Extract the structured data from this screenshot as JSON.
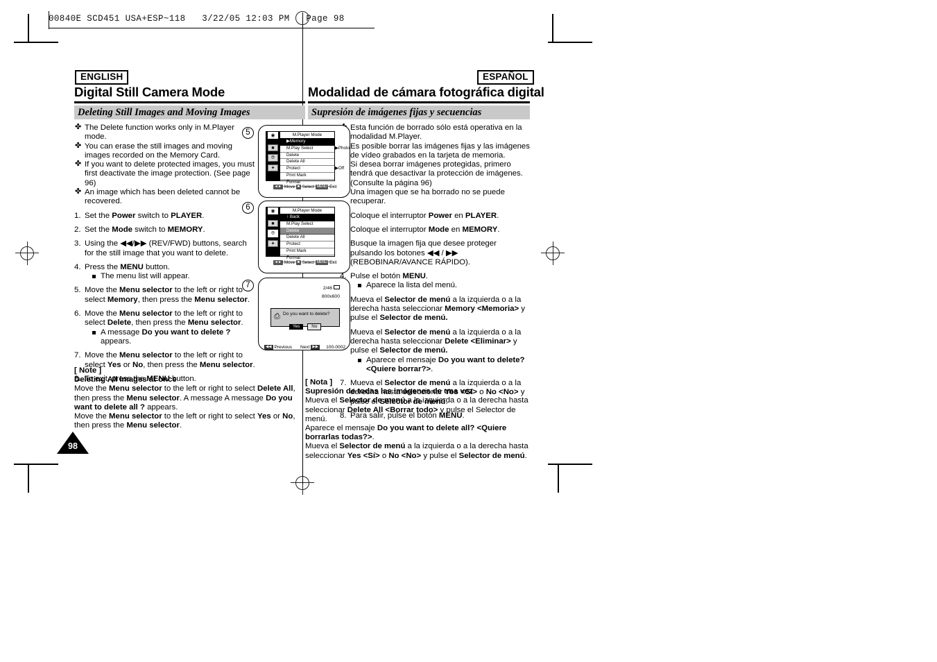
{
  "slug": {
    "text": "00840E SCD451 USA+ESP~118   3/22/05 12:03 PM   Page 98"
  },
  "page_number": "98",
  "english": {
    "lang_tag": "ENGLISH",
    "mode_title": "Digital Still Camera Mode",
    "section_title": "Deleting Still Images and Moving Images",
    "bullet_marker": "✤",
    "bullets": [
      "The Delete function works only in M.Player mode.",
      "You can erase the still images and moving images recorded on the Memory Card.",
      "If you want to delete protected images, you must first deactivate the image protection. (See page 96)",
      "An image which has been deleted cannot be recovered."
    ],
    "steps": [
      {
        "num": "1.",
        "html": "Set the <b>Power</b> switch to <b>PLAYER</b>."
      },
      {
        "num": "2.",
        "html": "Set the <b>Mode</b> switch to <b>MEMORY</b>."
      },
      {
        "num": "3.",
        "html": "Using the ◀◀/▶▶ (REV/FWD) buttons, search for the still image that you want to delete."
      },
      {
        "num": "4.",
        "html": "Press the <b>MENU</b> button.",
        "subs": [
          "The menu list will appear."
        ]
      },
      {
        "num": "5.",
        "html": "Move the <b>Menu selector</b> to the left or right to select <b>Memory</b>, then press the <b>Menu selector</b>."
      },
      {
        "num": "6.",
        "html": "Move the <b>Menu selector</b> to the left or right to select <b>Delete</b>, then press the <b>Menu selector</b>.",
        "subs": [
          "A message <b>Do you want to delete ?</b> appears."
        ]
      },
      {
        "num": "7.",
        "html": "Move the <b>Menu selector</b> to the left or right to select <b>Yes</b> or <b>No</b>, then press the <b>Menu selector</b>."
      },
      {
        "num": "8.",
        "html": "To exit, press the <b>MENU</b> button."
      }
    ],
    "note": {
      "label": "[ Note ]",
      "subtitle": "Deleting All images at once",
      "body_html": "Move the <b>Menu selector</b> to the left or right to select <b>Delete All</b>, then press the <b>Menu selector</b>. A message A message <b>Do you want to delete all ?</b> appears.<br>Move the <b>Menu selector</b> to the left or right to select <b>Yes</b> or <b>No</b>, then press the <b>Menu selector</b>."
    }
  },
  "spanish": {
    "lang_tag": "ESPAÑOL",
    "mode_title": "Modalidad de cámara fotográfica digital",
    "section_title": "Supresión de imágenes fijas y secuencias",
    "bullet_marker": "✤",
    "bullets": [
      "Esta función de borrado sólo está operativa en la modalidad M.Player.",
      "Es posible borrar las imágenes fijas y las imágenes de vídeo grabados en la tarjeta de memoria.",
      "Si desea borrar imágenes protegidas, primero tendrá que desactivar la protección de imágenes. (Consulte la página 96)",
      "Una imagen que se ha borrado no se puede recuperar."
    ],
    "steps": [
      {
        "num": "1.",
        "html": "Coloque el interruptor <b>Power</b> en <b>PLAYER</b>."
      },
      {
        "num": "2.",
        "html": "Coloque el interruptor <b>Mode</b> en <b>MEMORY</b>."
      },
      {
        "num": "3.",
        "html": "Busque la imagen fija que desee proteger pulsando los botones ◀◀ / ▶▶ (REBOBINAR/AVANCE RÁPIDO)."
      },
      {
        "num": "4.",
        "html": "Pulse el botón <b>MENU</b>.",
        "subs": [
          "Aparece la lista del menú."
        ]
      },
      {
        "num": "5.",
        "html": "Mueva el <b>Selector de menú</b> a la izquierda o a la derecha hasta seleccionar <b>Memory &lt;Memoria&gt;</b> y pulse el <b>Selector de menú.</b>"
      },
      {
        "num": "6.",
        "html": "Mueva el <b>Selector de menú</b> a la izquierda o a la derecha hasta seleccionar <b>Delete &lt;Eliminar&gt;</b> y pulse el <b>Selector de menú.</b>",
        "subs": [
          "Aparece el mensaje <b>Do you want to delete? &lt;Quiere borrar?&gt;</b>."
        ]
      },
      {
        "num": "7.",
        "html": "Mueva el <b>Selector de menú</b> a la izquierda o a la derecha hasta seleccionar <b>Yes &lt;Sí&gt;</b> o <b>No &lt;No&gt;</b> y pulse el <b>Selector de menú</b>."
      },
      {
        "num": "8.",
        "html": "Para salir, pulse el botón <b>MENU</b>."
      }
    ],
    "note": {
      "label": "[ Nota ]",
      "subtitle": "Supresión de todas las imágenes de una vez",
      "body_html": "Mueva el <b>Selector de menú</b> a la izquierda o a la derecha hasta seleccionar <b>Delete All &lt;Borrar todo&gt;</b> y pulse el Selector de menú.<br>Aparece el mensaje <b>Do you want to delete all? &lt;Quiere borrarlas todas?&gt;</b>.<br>Mueva el <b>Selector de menú</b> a la izquierda o a la derecha hasta seleccionar <b>Yes &lt;Sí&gt;</b> o <b>No &lt;No&gt;</b> y pulse el <b>Selector de menú</b>."
    }
  },
  "figures": {
    "step_labels": [
      "5",
      "6",
      "7"
    ],
    "lcd1": {
      "menu_title": "M.Player Mode",
      "rows": [
        {
          "label": "▶Memory",
          "value": "",
          "state": "black"
        },
        {
          "label": "M.Play Select",
          "value": "▶Photo",
          "state": "normal"
        },
        {
          "label": "Delete",
          "value": "",
          "state": "normal"
        },
        {
          "label": "Delete All",
          "value": "",
          "state": "normal"
        },
        {
          "label": "Protect",
          "value": "▶Off",
          "state": "normal"
        },
        {
          "label": "Print Mark",
          "value": "",
          "state": "normal"
        },
        {
          "label": "Format",
          "value": "",
          "state": "normal"
        }
      ],
      "footer": {
        "move": "Move",
        "select": "Select",
        "exit": "Exit",
        "exit_key": "MENU"
      }
    },
    "lcd2": {
      "menu_title": "M.Player Mode",
      "rows": [
        {
          "label": "↑ Back",
          "value": "",
          "state": "black"
        },
        {
          "label": "M.Play Select",
          "value": "",
          "state": "normal"
        },
        {
          "label": "Delete",
          "value": "",
          "state": "grey"
        },
        {
          "label": "Delete All",
          "value": "",
          "state": "normal"
        },
        {
          "label": "Protect",
          "value": "",
          "state": "normal"
        },
        {
          "label": "Print Mark",
          "value": "",
          "state": "normal"
        },
        {
          "label": "Format",
          "value": "",
          "state": "normal"
        }
      ],
      "footer": {
        "move": "Move",
        "select": "Select",
        "exit": "Exit",
        "exit_key": "MENU"
      }
    },
    "lcd3": {
      "counter": "2/46",
      "resolution": "800x600",
      "dialog_message": "Do you want to delete?",
      "yes_label": "Yes",
      "no_label": "No",
      "previous_label": "Previous",
      "next_label": "Next",
      "file_number": "100-0002"
    }
  }
}
